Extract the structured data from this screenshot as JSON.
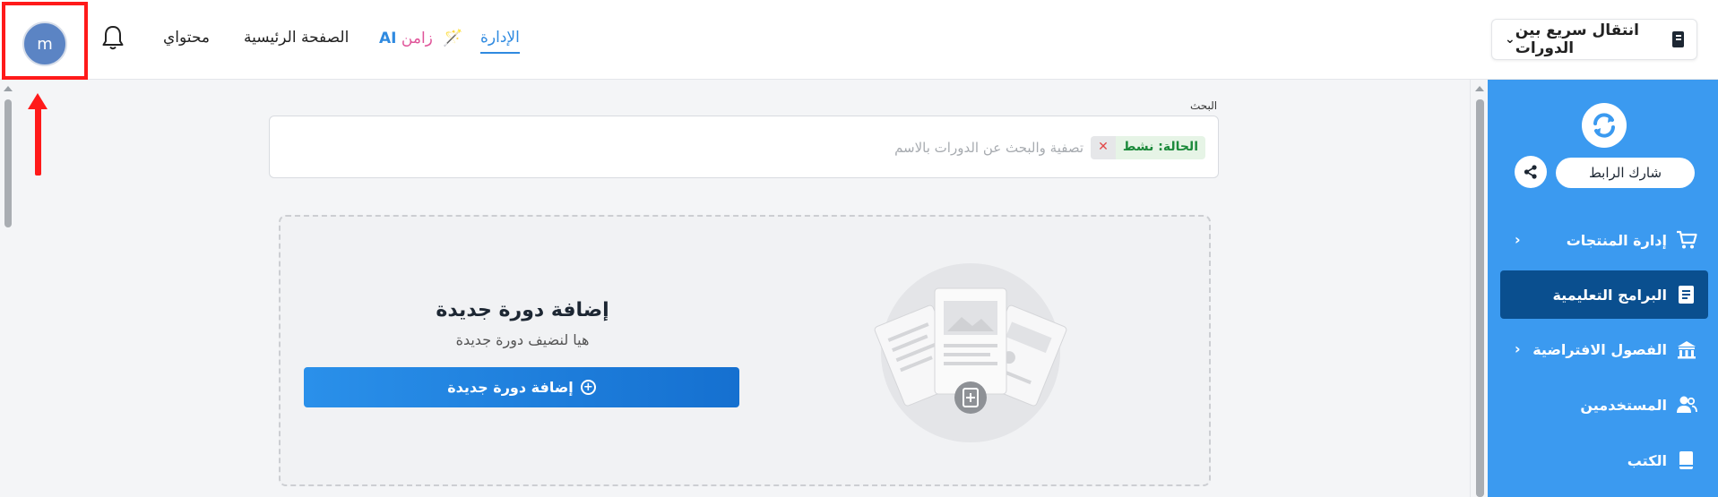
{
  "header": {
    "avatar_letter": "m",
    "nav": {
      "content": "محتواي",
      "home": "الصفحة الرئيسية",
      "ai_word": "زامن",
      "ai_suffix": "AI",
      "admin": "الإدارة"
    },
    "quick_switch": "انتقال سريع بين الدورات"
  },
  "search": {
    "label": "البحث",
    "placeholder": "تصفية والبحث عن الدورات بالاسم",
    "status_chip": "الحالة: نشط",
    "clear_symbol": "✕"
  },
  "add_course": {
    "title": "إضافة دورة جديدة",
    "subtitle": "هيا لنضيف دورة جديدة",
    "button_label": "إضافة دورة جديدة"
  },
  "sidebar": {
    "share_label": "شارك الرابط",
    "items": [
      {
        "label": "إدارة المنتجات",
        "icon": "cart-icon",
        "has_submenu": true
      },
      {
        "label": "البرامج التعليمية",
        "icon": "book-icon",
        "active": true
      },
      {
        "label": "الفصول الافتراضية",
        "icon": "school-icon",
        "has_submenu": true
      },
      {
        "label": "المستخدمين",
        "icon": "users-icon"
      },
      {
        "label": "الكتب",
        "icon": "books-icon"
      }
    ]
  },
  "colors": {
    "sidebar": "#3b9af0",
    "sidebar_active": "#0a4f8f",
    "accent": "#2f8ae0",
    "highlight": "#ff1a1a",
    "status_green": "#1c8a3b"
  }
}
